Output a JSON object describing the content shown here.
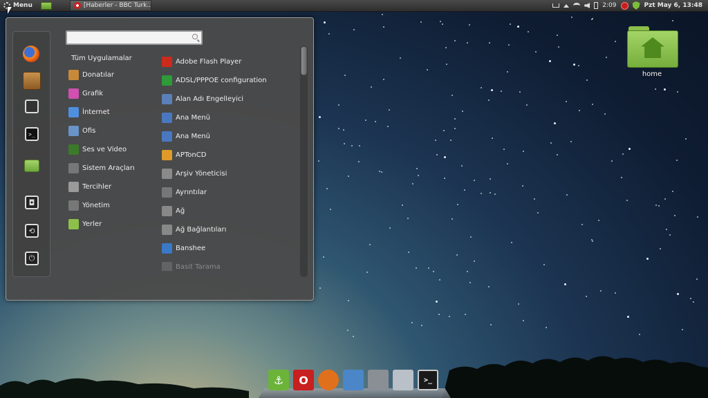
{
  "panel": {
    "menu_label": "Menu",
    "task_title": "[Haberler - BBC Turk...",
    "battery_time": "2:09",
    "clock": "Pzt May  6, 13:48"
  },
  "menu": {
    "search": {
      "value": "",
      "placeholder": ""
    },
    "favorites": [
      {
        "name": "firefox-icon"
      },
      {
        "name": "package-installer-icon"
      },
      {
        "name": "system-settings-icon"
      },
      {
        "name": "terminal-icon"
      },
      {
        "name": "folder-icon"
      },
      {
        "name": "lock-screen-icon"
      },
      {
        "name": "logout-icon"
      },
      {
        "name": "shutdown-icon"
      }
    ],
    "categories": [
      {
        "label": "Tüm Uygulamalar",
        "icon": ""
      },
      {
        "label": "Donatılar",
        "icon": "accessories-icon",
        "color": "#c8893a"
      },
      {
        "label": "Grafik",
        "icon": "graphics-icon",
        "color": "#d14fb0"
      },
      {
        "label": "İnternet",
        "icon": "internet-icon",
        "color": "#4f8fe0"
      },
      {
        "label": "Ofis",
        "icon": "office-icon",
        "color": "#6a93c8"
      },
      {
        "label": "Ses ve Video",
        "icon": "multimedia-icon",
        "color": "#3b7a2a"
      },
      {
        "label": "Sistem Araçları",
        "icon": "system-tools-icon",
        "color": "#777777"
      },
      {
        "label": "Tercihler",
        "icon": "preferences-icon",
        "color": "#9a9a9a"
      },
      {
        "label": "Yönetim",
        "icon": "administration-icon",
        "color": "#777777"
      },
      {
        "label": "Yerler",
        "icon": "places-folder-icon",
        "color": "#8cc04a"
      }
    ],
    "apps": [
      {
        "label": "Adobe Flash Player",
        "icon": "flash-player-icon",
        "color": "#cc2a1a"
      },
      {
        "label": "ADSL/PPPOE configuration",
        "icon": "network-config-icon",
        "color": "#2e9a3a"
      },
      {
        "label": "Alan Adı Engelleyici",
        "icon": "domain-blocker-icon",
        "color": "#5b7fb8"
      },
      {
        "label": "Ana Menü",
        "icon": "main-menu-icon",
        "color": "#4a78c0"
      },
      {
        "label": "Ana Menü",
        "icon": "main-menu-icon",
        "color": "#4a78c0"
      },
      {
        "label": "APTonCD",
        "icon": "aptoncd-icon",
        "color": "#e09a2a"
      },
      {
        "label": "Arşiv Yöneticisi",
        "icon": "archive-manager-icon",
        "color": "#8a8a8a"
      },
      {
        "label": "Ayrıntılar",
        "icon": "details-icon",
        "color": "#777777"
      },
      {
        "label": "Ağ",
        "icon": "network-icon",
        "color": "#888888"
      },
      {
        "label": "Ağ Bağlantıları",
        "icon": "network-connections-icon",
        "color": "#888888"
      },
      {
        "label": "Banshee",
        "icon": "banshee-icon",
        "color": "#3a78c8"
      },
      {
        "label": "Basit Tarama",
        "icon": "scanner-icon",
        "color": "#888888"
      }
    ]
  },
  "desktop": {
    "home_label": "home"
  },
  "dock": [
    {
      "name": "anchor-app-icon",
      "color": "#6cb33a",
      "glyph": "⚓"
    },
    {
      "name": "opera-icon",
      "color": "#c81f1f",
      "glyph": "O"
    },
    {
      "name": "firefox-icon",
      "color": "#e0701c",
      "glyph": ""
    },
    {
      "name": "chromium-icon",
      "color": "#4a86c8",
      "glyph": ""
    },
    {
      "name": "droplet-app-icon",
      "color": "#8a8f96",
      "glyph": ""
    },
    {
      "name": "disc-burner-icon",
      "color": "#b9c0c8",
      "glyph": ""
    },
    {
      "name": "terminal-icon",
      "color": "#1a1a1a",
      "glyph": ">_"
    }
  ]
}
